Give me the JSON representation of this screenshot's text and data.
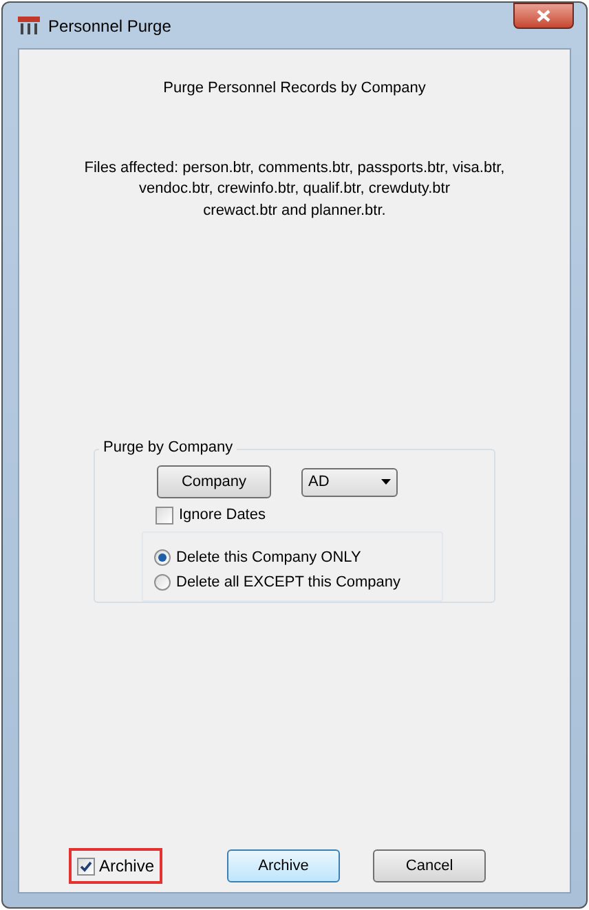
{
  "window": {
    "title": "Personnel Purge"
  },
  "heading": "Purge Personnel Records by Company",
  "files_affected": [
    "Files affected: person.btr, comments.btr, passports.btr, visa.btr,",
    "vendoc.btr, crewinfo.btr, qualif.btr, crewduty.btr",
    "crewact.btr and planner.btr."
  ],
  "group": {
    "title": "Purge by Company",
    "company_button": "Company",
    "company_select": {
      "value": "AD"
    },
    "ignore_dates": {
      "label": "Ignore Dates",
      "checked": false
    },
    "options": [
      {
        "label": "Delete this Company ONLY",
        "selected": true
      },
      {
        "label": "Delete all EXCEPT this Company",
        "selected": false
      }
    ]
  },
  "archive_checkbox": {
    "label": "Archive",
    "checked": true,
    "highlighted": true
  },
  "buttons": [
    {
      "label": "Archive",
      "default": true
    },
    {
      "label": "Cancel",
      "default": false
    }
  ]
}
